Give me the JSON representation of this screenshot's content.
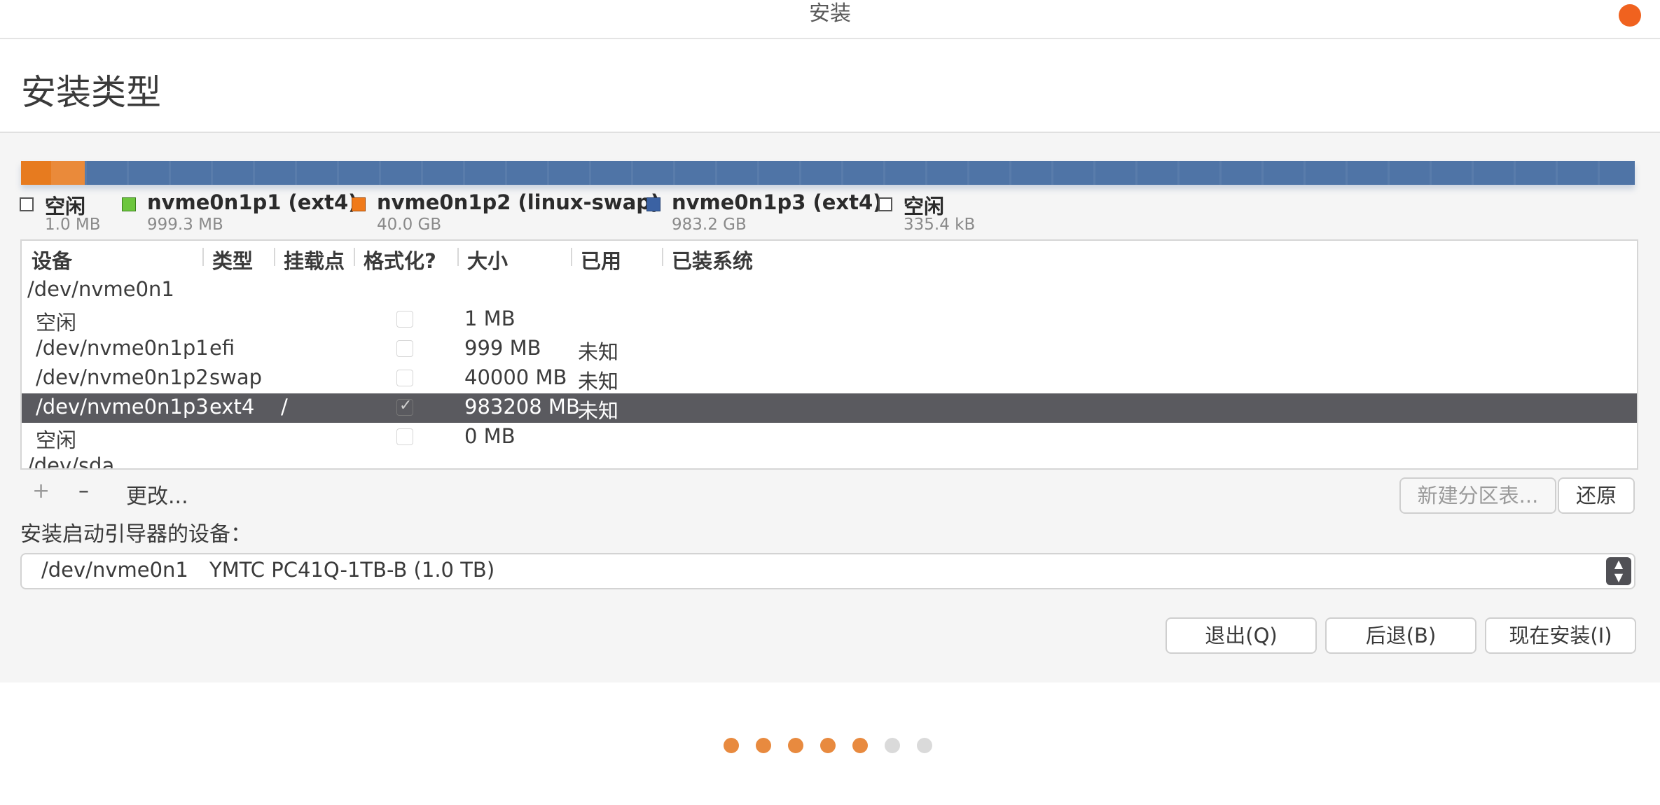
{
  "window": {
    "title": "安装",
    "close_color": "#f0621f"
  },
  "page": {
    "title": "安装类型"
  },
  "disk_bar": {
    "colors": {
      "efi": "#e77b1f",
      "swap": "#ea8a3a",
      "root": "#4f74a6"
    }
  },
  "legend": [
    {
      "name": "空闲",
      "size": "1.0 MB",
      "swatch": "free"
    },
    {
      "name": "nvme0n1p1 (ext4)",
      "size": "999.3 MB",
      "swatch": "green"
    },
    {
      "name": "nvme0n1p2 (linux-swap)",
      "size": "40.0 GB",
      "swatch": "orange"
    },
    {
      "name": "nvme0n1p3 (ext4)",
      "size": "983.2 GB",
      "swatch": "blue"
    },
    {
      "name": "空闲",
      "size": "335.4 kB",
      "swatch": "free"
    }
  ],
  "table": {
    "columns": [
      "设备",
      "类型",
      "挂载点",
      "格式化?",
      "大小",
      "已用",
      "已装系统"
    ],
    "rows": [
      {
        "device": "/dev/nvme0n1",
        "type": "",
        "mount": "",
        "format": null,
        "size": "",
        "used": "",
        "system": ""
      },
      {
        "device": "空闲",
        "type": "",
        "mount": "",
        "format": false,
        "size": "1 MB",
        "used": "",
        "system": ""
      },
      {
        "device": "/dev/nvme0n1p1",
        "type": "efi",
        "mount": "",
        "format": false,
        "size": "999 MB",
        "used": "未知",
        "system": ""
      },
      {
        "device": "/dev/nvme0n1p2",
        "type": "swap",
        "mount": "",
        "format": false,
        "size": "40000 MB",
        "used": "未知",
        "system": ""
      },
      {
        "device": "/dev/nvme0n1p3",
        "type": "ext4",
        "mount": "/",
        "format": true,
        "size": "983208 MB",
        "used": "未知",
        "system": "",
        "selected": true
      },
      {
        "device": "空闲",
        "type": "",
        "mount": "",
        "format": false,
        "size": "0 MB",
        "used": "",
        "system": ""
      },
      {
        "device": "/dev/sda",
        "type": "",
        "mount": "",
        "format": null,
        "size": "",
        "used": "",
        "system": ""
      }
    ],
    "check_mark": "✓"
  },
  "toolbar": {
    "add": "+",
    "remove": "–",
    "change": "更改...",
    "new_table": "新建分区表...",
    "revert": "还原"
  },
  "bootloader": {
    "label": "安装启动引导器的设备：",
    "device": "/dev/nvme0n1",
    "model": "YMTC PC41Q-1TB-B (1.0 TB)",
    "arrow_up": "▲",
    "arrow_down": "▼"
  },
  "actions": {
    "quit": "退出(Q)",
    "back": "后退(B)",
    "install": "现在安装(I)"
  },
  "progress": {
    "total": 7,
    "completed": 5,
    "on_color": "#e88a3f",
    "off_color": "#dadada"
  }
}
